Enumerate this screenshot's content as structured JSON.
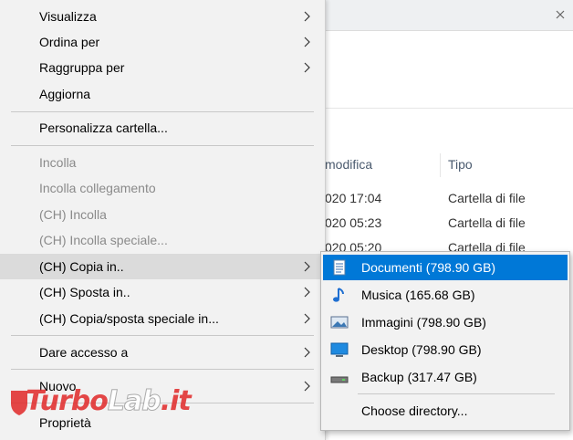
{
  "background": {
    "column_modified": "modifica",
    "column_type": "Tipo",
    "rows": [
      {
        "date": "020 17:04",
        "type": "Cartella di file"
      },
      {
        "date": "020 05:23",
        "type": "Cartella di file"
      },
      {
        "date": "020 05:20",
        "type": "Cartella di file"
      }
    ]
  },
  "context_menu": {
    "items": [
      {
        "label": "Visualizza",
        "submenu": true,
        "enabled": true
      },
      {
        "label": "Ordina per",
        "submenu": true,
        "enabled": true
      },
      {
        "label": "Raggruppa per",
        "submenu": true,
        "enabled": true
      },
      {
        "label": "Aggiorna",
        "submenu": false,
        "enabled": true
      },
      {
        "label": "Personalizza cartella...",
        "submenu": false,
        "enabled": true
      },
      {
        "label": "Incolla",
        "submenu": false,
        "enabled": false
      },
      {
        "label": "Incolla collegamento",
        "submenu": false,
        "enabled": false
      },
      {
        "label": "(CH) Incolla",
        "submenu": false,
        "enabled": false
      },
      {
        "label": "(CH) Incolla speciale...",
        "submenu": false,
        "enabled": false
      },
      {
        "label": "(CH) Copia in..",
        "submenu": true,
        "enabled": true,
        "highlighted": true
      },
      {
        "label": "(CH) Sposta in..",
        "submenu": true,
        "enabled": true
      },
      {
        "label": "(CH) Copia/sposta speciale in...",
        "submenu": true,
        "enabled": true
      },
      {
        "label": "Dare accesso a",
        "submenu": true,
        "enabled": true
      },
      {
        "label": "Nuovo",
        "submenu": true,
        "enabled": true
      },
      {
        "label": "Proprietà",
        "submenu": false,
        "enabled": true
      }
    ]
  },
  "submenu": {
    "items": [
      {
        "label": "Documenti (798.90 GB)",
        "icon": "document-icon",
        "selected": true
      },
      {
        "label": "Musica (165.68 GB)",
        "icon": "music-note-icon"
      },
      {
        "label": "Immagini (798.90 GB)",
        "icon": "picture-icon"
      },
      {
        "label": "Desktop (798.90 GB)",
        "icon": "desktop-icon"
      },
      {
        "label": "Backup (317.47 GB)",
        "icon": "drive-icon"
      }
    ],
    "choose_directory": "Choose directory..."
  },
  "watermark": {
    "part1": "Turbo",
    "part2": "Lab",
    "part3": ".it"
  },
  "colors": {
    "accent": "#0078d7",
    "menu_bg": "#f2f2f2",
    "highlight": "#dbdbdb",
    "disabled_text": "#8a8a8a",
    "watermark": "#e12828"
  }
}
